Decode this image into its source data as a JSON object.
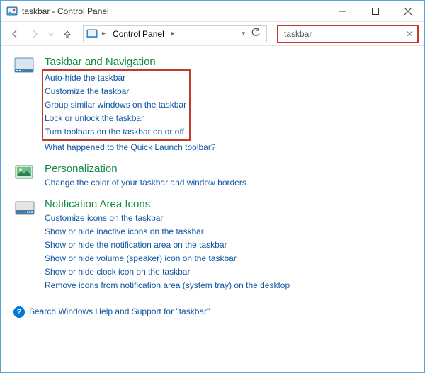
{
  "window": {
    "title": "taskbar - Control Panel"
  },
  "addressbar": {
    "root": "Control Panel"
  },
  "search": {
    "value": "taskbar"
  },
  "sections": [
    {
      "title": "Taskbar and Navigation",
      "boxed_links": [
        "Auto-hide the taskbar",
        "Customize the taskbar",
        "Group similar windows on the taskbar",
        "Lock or unlock the taskbar",
        "Turn toolbars on the taskbar on or off"
      ],
      "links": [
        "What happened to the Quick Launch toolbar?"
      ]
    },
    {
      "title": "Personalization",
      "links": [
        "Change the color of your taskbar and window borders"
      ]
    },
    {
      "title": "Notification Area Icons",
      "links": [
        "Customize icons on the taskbar",
        "Show or hide inactive icons on the taskbar",
        "Show or hide the notification area on the taskbar",
        "Show or hide volume (speaker) icon on the taskbar",
        "Show or hide clock icon on the taskbar",
        "Remove icons from notification area (system tray) on the desktop"
      ]
    }
  ],
  "help": {
    "text": "Search Windows Help and Support for \"taskbar\""
  }
}
